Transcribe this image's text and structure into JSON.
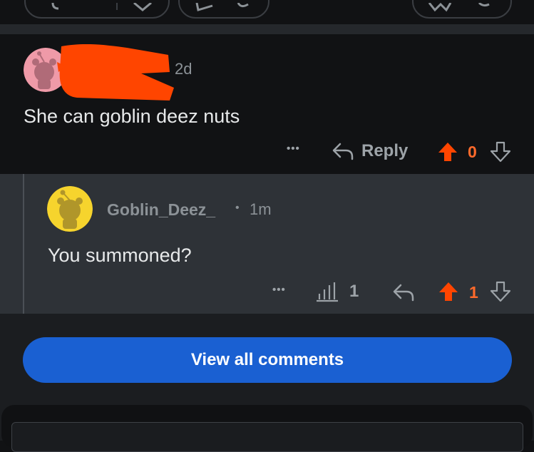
{
  "comment": {
    "time": "2d",
    "body": "She can goblin deez nuts",
    "more_label": "•••",
    "reply_label": "Reply",
    "score": "0"
  },
  "reply": {
    "username": "Goblin_Deez_",
    "dot": "•",
    "time": "1m",
    "body": "You summoned?",
    "more_label": "•••",
    "views": "1",
    "score": "1"
  },
  "view_all_label": "View all comments",
  "colors": {
    "upvote": "#ff4500",
    "button": "#1a60d2",
    "redaction": "#ff4500"
  },
  "icons": {
    "reply": "reply-arrow-icon",
    "views": "bar-chart-icon",
    "upvote": "upvote-icon",
    "downvote": "downvote-icon",
    "avatar": "snoo-avatar-icon"
  }
}
